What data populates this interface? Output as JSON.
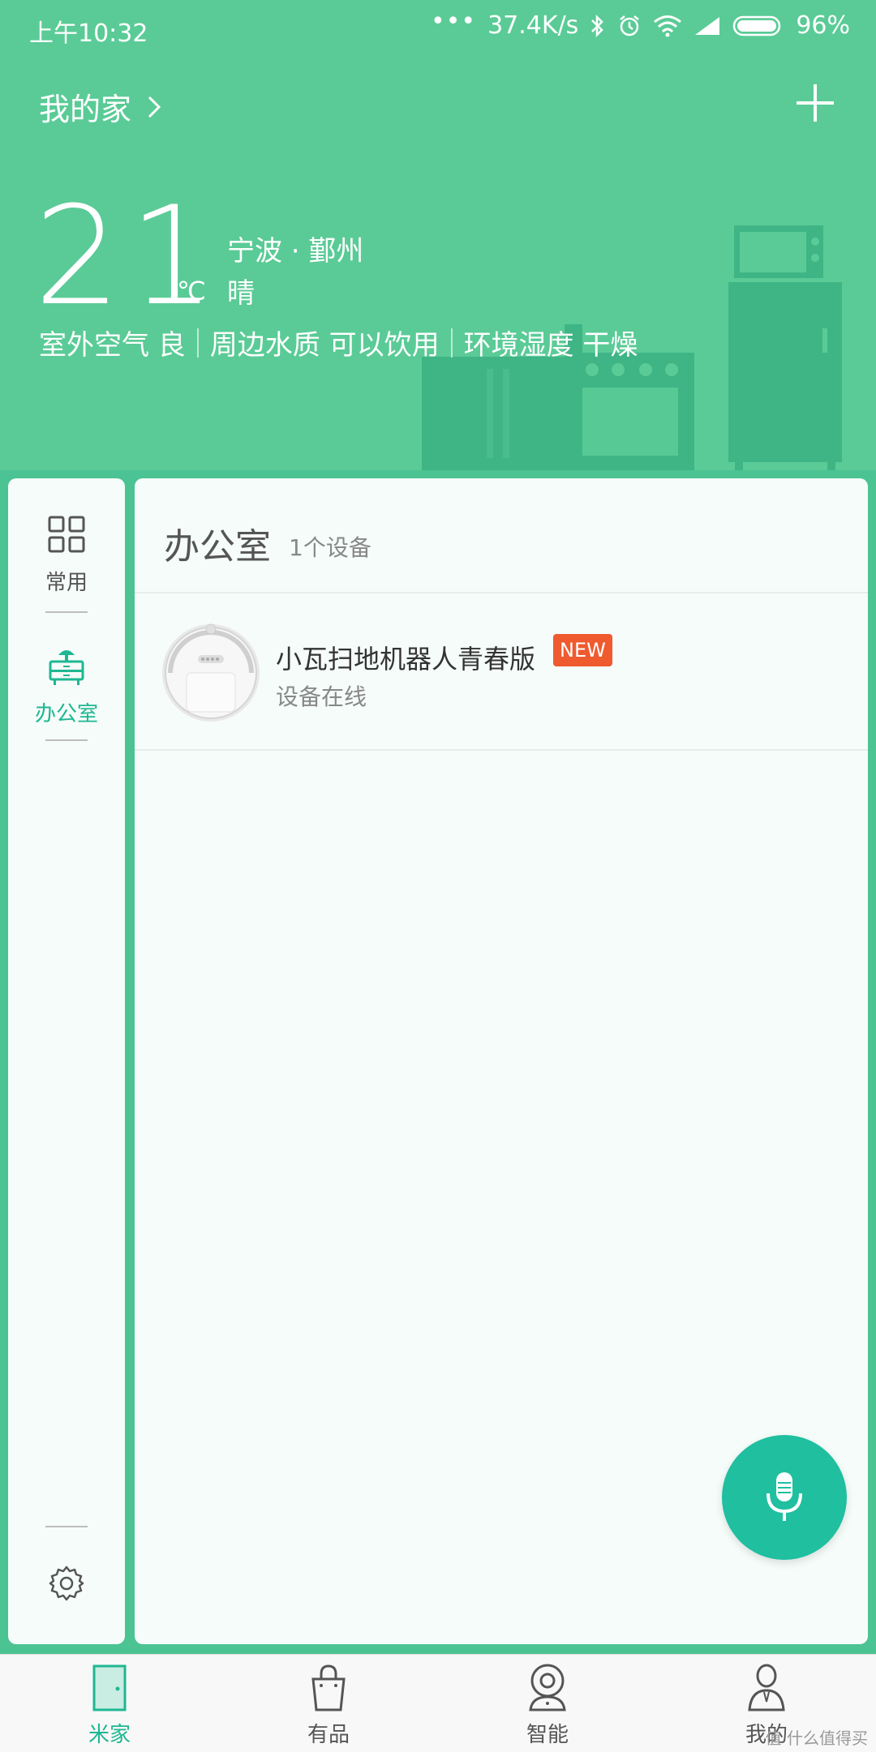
{
  "status_bar": {
    "time": "上午10:32",
    "dots": "•••",
    "speed": "37.4K/s",
    "battery": "96%",
    "icons": [
      "bluetooth-icon",
      "alarm-icon",
      "wifi-icon",
      "signal-icon",
      "battery-icon"
    ]
  },
  "header": {
    "home_name": "我的家",
    "temperature": "21",
    "unit": "℃",
    "city": "宁波 · 鄞州",
    "weather": "晴",
    "air": "室外空气 良",
    "water": "周边水质 可以饮用",
    "humidity": "环境湿度 干燥"
  },
  "sidebar": {
    "items": [
      {
        "label": "常用",
        "icon": "grid-icon",
        "active": false
      },
      {
        "label": "办公室",
        "icon": "office-desk-icon",
        "active": true
      }
    ]
  },
  "room": {
    "title": "办公室",
    "count": "1个设备"
  },
  "devices": [
    {
      "name": "小瓦扫地机器人青春版",
      "badge": "NEW",
      "status": "设备在线"
    }
  ],
  "tabs": [
    {
      "label": "米家",
      "icon": "door-icon",
      "active": true
    },
    {
      "label": "有品",
      "icon": "shopping-bag-icon",
      "active": false
    },
    {
      "label": "智能",
      "icon": "camera-icon",
      "active": false
    },
    {
      "label": "我的",
      "icon": "person-icon",
      "active": false
    }
  ],
  "watermark": "值 什么值得买",
  "colors": {
    "header_bg": "#5acb96",
    "accent": "#1fb792",
    "badge": "#f05a2f",
    "mic_bg": "#1fbf9f"
  }
}
